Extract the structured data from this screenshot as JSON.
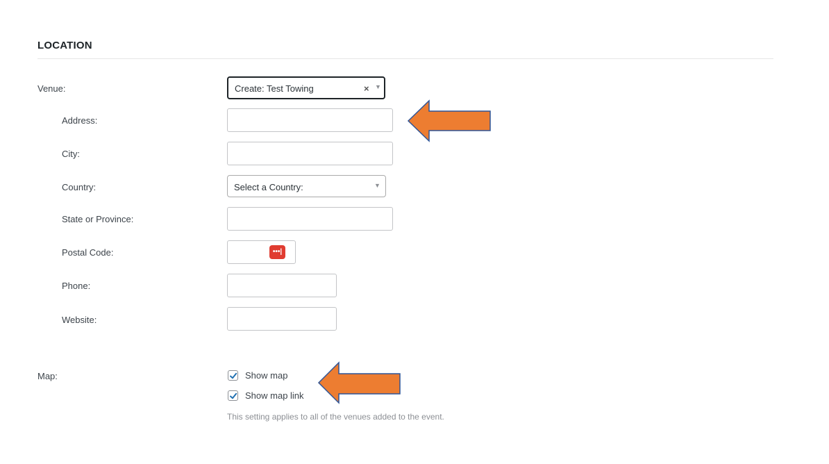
{
  "section": {
    "title": "LOCATION"
  },
  "venue": {
    "label": "Venue:",
    "selected": "Create: Test Towing",
    "clear_symbol": "×",
    "caret": "▼"
  },
  "address": {
    "label": "Address:",
    "value": ""
  },
  "city": {
    "label": "City:",
    "value": ""
  },
  "country": {
    "label": "Country:",
    "placeholder": "Select a Country:",
    "caret": "▼"
  },
  "state": {
    "label": "State or Province:",
    "value": ""
  },
  "postal": {
    "label": "Postal Code:",
    "value": "",
    "password_manager_icon": "password-manager-icon"
  },
  "phone": {
    "label": "Phone:",
    "value": ""
  },
  "website": {
    "label": "Website:",
    "value": ""
  },
  "map": {
    "label": "Map:",
    "show_map": {
      "label": "Show map",
      "checked": true
    },
    "show_map_link": {
      "label": "Show map link",
      "checked": true
    },
    "help_text": "This setting applies to all of the venues added to the event."
  },
  "colors": {
    "annotation_arrow_fill": "#ed7d31",
    "annotation_arrow_stroke": "#2f5597",
    "checkbox_check": "#2271b1",
    "password_icon": "#e03c31"
  }
}
